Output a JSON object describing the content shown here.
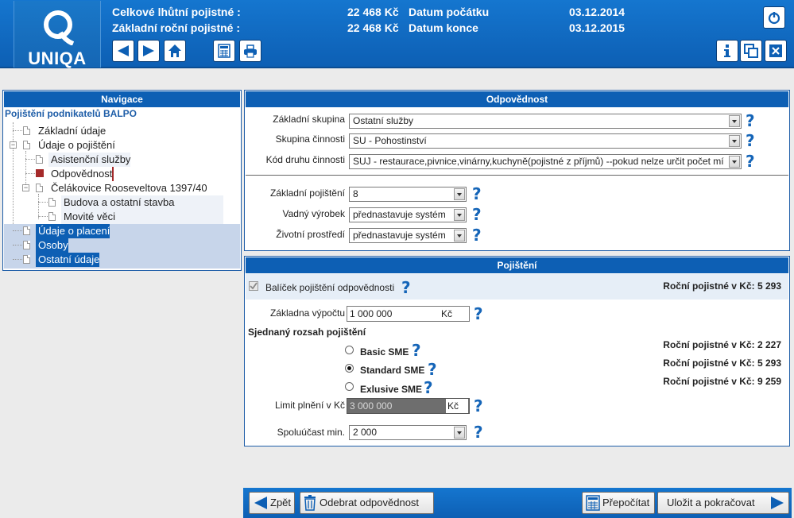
{
  "header": {
    "logo_text": "UNIQA",
    "total_premium_label": "Celkové lhůtní pojistné :",
    "total_premium_value": "22 468 Kč",
    "annual_premium_label": "Základní roční pojistné :",
    "annual_premium_value": "22 468 Kč",
    "start_date_label": "Datum počátku",
    "start_date_value": "03.12.2014",
    "end_date_label": "Datum konce",
    "end_date_value": "03.12.2015"
  },
  "nav": {
    "title": "Navigace",
    "heading": "Pojištění podnikatelů BALPO",
    "items": [
      {
        "label": "Základní údaje"
      },
      {
        "label": "Údaje o pojištění"
      },
      {
        "label": "Asistenční služby"
      },
      {
        "label": "Odpovědnost"
      },
      {
        "label": "Čelákovice Rooseveltova 1397/40"
      },
      {
        "label": "Budova a ostatní stavba"
      },
      {
        "label": "Movité věci"
      },
      {
        "label": "Údaje o placení"
      },
      {
        "label": "Osoby"
      },
      {
        "label": "Ostatní údaje"
      }
    ]
  },
  "liability": {
    "title": "Odpovědnost",
    "base_group_label": "Základní skupina",
    "base_group_value": "Ostatní služby",
    "activity_group_label": "Skupina činnosti",
    "activity_group_value": "SU - Pohostinství",
    "activity_code_label": "Kód druhu činnosti",
    "activity_code_value": "SUJ - restaurace,pivnice,vinárny,kuchyně(pojistné z příjmů) --pokud nelze určit počet mí",
    "basic_insurance_label": "Základní pojištění",
    "basic_insurance_value": "8",
    "defective_product_label": "Vadný výrobek",
    "defective_product_value": "přednastavuje systém",
    "environment_label": "Životní prostředí",
    "environment_value": "přednastavuje systém"
  },
  "insurance": {
    "title": "Pojištění",
    "package_label": "Balíček pojištění odpovědnosti",
    "package_premium": "Roční pojistné v Kč: 5 293",
    "calc_base_label": "Základna výpočtu",
    "calc_base_value": "1 000 000",
    "calc_base_unit": "Kč",
    "scope_label": "Sjednaný rozsah pojištění",
    "options": [
      {
        "label": "Basic SME",
        "premium": "Roční pojistné v Kč: 2 227",
        "selected": false
      },
      {
        "label": "Standard SME",
        "premium": "Roční pojistné v Kč: 5 293",
        "selected": true
      },
      {
        "label": "Exlusive SME",
        "premium": "Roční pojistné v Kč: 9 259",
        "selected": false
      }
    ],
    "limit_label": "Limit plnění v Kč",
    "limit_value": "3 000 000",
    "limit_unit": "Kč",
    "deductible_label": "Spoluúčast min.",
    "deductible_value": "2 000"
  },
  "footer": {
    "back_label": "Zpět",
    "remove_label": "Odebrat odpovědnost",
    "recalc_label": "Přepočítat",
    "save_continue_label": "Uložit a pokračovat"
  },
  "colors": {
    "header_blue": "#0d5fb4",
    "help_blue": "#1565b8",
    "nav_selected_bg": "#c7d5ea",
    "nav_active_marker": "#a52a2a"
  }
}
